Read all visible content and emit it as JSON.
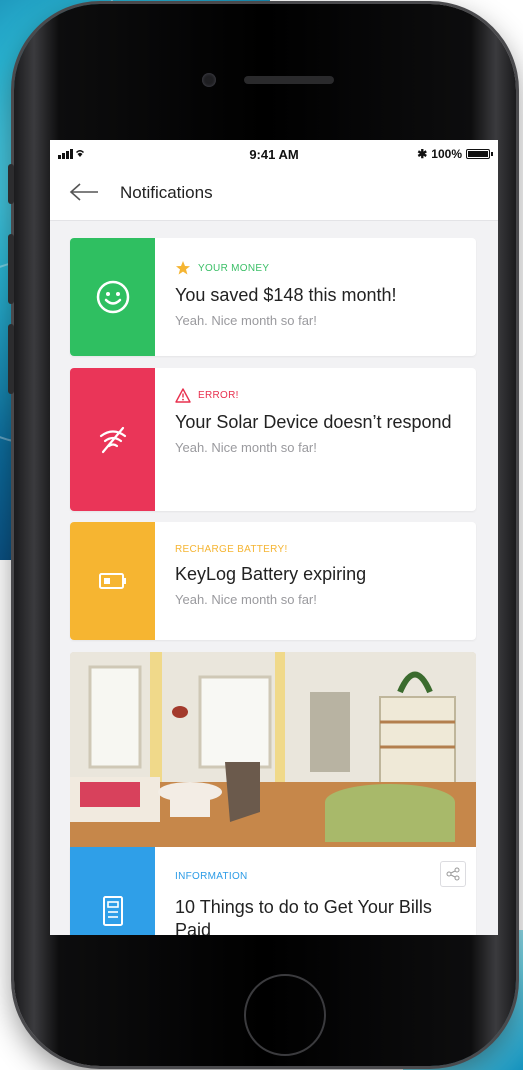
{
  "status_bar": {
    "signal": "•••• ▼",
    "time": "9:41 AM",
    "bluetooth": "✱",
    "battery_percent": "100%"
  },
  "header": {
    "title": "Notifications",
    "back_icon": "arrow-left-icon"
  },
  "notifications": [
    {
      "tag": "YOUR MONEY",
      "tag_color": "#3bbf67",
      "tag_icon": "star-icon",
      "title": "You saved $148 this month!",
      "subtitle": "Yeah. Nice month so far!",
      "accent": "#2fbf61",
      "icon": "smiley-icon"
    },
    {
      "tag": "ERROR!",
      "tag_color": "#e8304e",
      "tag_icon": "warning-icon",
      "title": "Your Solar Device doesn’t respond",
      "subtitle": "Yeah. Nice month so far!",
      "accent": "#ea3558",
      "icon": "no-connection-icon"
    },
    {
      "tag": "RECHARGE BATTERY!",
      "tag_color": "#f5b533",
      "tag_icon": "",
      "title": "KeyLog Battery expiring",
      "subtitle": "Yeah. Nice month so far!",
      "accent": "#f6b531",
      "icon": "battery-low-icon"
    },
    {
      "tag": "INFORMATION",
      "tag_color": "#2b9be6",
      "tag_icon": "",
      "title": "10 Things to do to Get Your Bills Paid",
      "accent": "#2f9fe8",
      "icon": "document-icon",
      "image": "living-room-photo",
      "action_icon": "share-icon"
    }
  ]
}
